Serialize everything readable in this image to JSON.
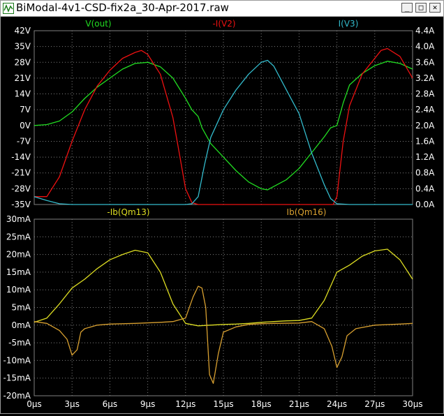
{
  "window": {
    "title": "BiModal-4v1-CSD-fix2a_30-Apr-2017.raw",
    "icon": "ltspice-waveform-icon",
    "buttons": [
      {
        "name": "minimize-button",
        "glyph": "_"
      },
      {
        "name": "maximize-button",
        "glyph": "□"
      },
      {
        "name": "close-button",
        "glyph": "✕"
      }
    ]
  },
  "colors": {
    "background": "#000000",
    "grid": "#7f7f7f",
    "axis_text": "#ffffff",
    "v_out": "#22dd22",
    "neg_i_v2": "#ee1111",
    "i_v3": "#33bbcc",
    "neg_ib_qm13": "#dddd22",
    "ib_qm16": "#d8a030"
  },
  "chart_data": [
    {
      "type": "line",
      "pane": "top",
      "left_axis": {
        "unit": "V",
        "ticks": [
          "42V",
          "35V",
          "28V",
          "21V",
          "14V",
          "7V",
          "0V",
          "-7V",
          "-14V",
          "-21V",
          "-28V",
          "-35V"
        ],
        "ylim": [
          -35,
          42
        ]
      },
      "right_axis": {
        "unit": "A",
        "ticks": [
          "4.4A",
          "4.0A",
          "3.6A",
          "3.2A",
          "2.8A",
          "2.4A",
          "2.0A",
          "1.6A",
          "1.2A",
          "0.8A",
          "0.4A",
          "0.0A"
        ],
        "ylim": [
          0.0,
          4.4
        ]
      },
      "xlim": [
        0,
        30
      ],
      "grid": true,
      "series": [
        {
          "name": "V(out)",
          "axis": "left",
          "color": "#22dd22",
          "points": [
            [
              0,
              0
            ],
            [
              1,
              0.4
            ],
            [
              2,
              2
            ],
            [
              3,
              6
            ],
            [
              4,
              12
            ],
            [
              5,
              17
            ],
            [
              6,
              21
            ],
            [
              7,
              25
            ],
            [
              8,
              27.5
            ],
            [
              9,
              28
            ],
            [
              10,
              26
            ],
            [
              11,
              21
            ],
            [
              12,
              12
            ],
            [
              12.5,
              7
            ],
            [
              13,
              4
            ],
            [
              13.3,
              -1
            ],
            [
              14,
              -8
            ],
            [
              15,
              -14
            ],
            [
              16,
              -20
            ],
            [
              17,
              -25
            ],
            [
              18,
              -28
            ],
            [
              18.5,
              -28.5
            ],
            [
              19,
              -27
            ],
            [
              20,
              -24
            ],
            [
              21,
              -19
            ],
            [
              22,
              -12
            ],
            [
              23,
              -5
            ],
            [
              23.5,
              -1
            ],
            [
              24,
              0
            ],
            [
              24.5,
              10
            ],
            [
              25,
              18
            ],
            [
              26,
              23
            ],
            [
              27,
              26.5
            ],
            [
              28,
              28.5
            ],
            [
              29,
              27.5
            ],
            [
              30,
              25
            ]
          ]
        },
        {
          "name": "-I(V2)",
          "axis": "right",
          "color": "#ee1111",
          "points": [
            [
              0,
              0.2
            ],
            [
              1,
              0.2
            ],
            [
              2,
              0.7
            ],
            [
              3,
              1.6
            ],
            [
              4,
              2.4
            ],
            [
              5,
              3.0
            ],
            [
              6,
              3.4
            ],
            [
              7,
              3.7
            ],
            [
              8,
              3.85
            ],
            [
              8.5,
              3.9
            ],
            [
              9,
              3.8
            ],
            [
              10,
              3.3
            ],
            [
              11,
              2.2
            ],
            [
              11.5,
              1.3
            ],
            [
              12,
              0.4
            ],
            [
              12.5,
              0.05
            ],
            [
              13,
              0.0
            ],
            [
              23.7,
              0.0
            ],
            [
              24,
              0.2
            ],
            [
              24.5,
              1.6
            ],
            [
              25,
              2.5
            ],
            [
              26,
              3.3
            ],
            [
              27,
              3.7
            ],
            [
              27.5,
              3.9
            ],
            [
              28,
              3.95
            ],
            [
              29,
              3.75
            ],
            [
              30,
              3.2
            ]
          ]
        },
        {
          "name": "I(V3)",
          "axis": "right",
          "color": "#33bbcc",
          "points": [
            [
              0,
              0.2
            ],
            [
              1,
              0.1
            ],
            [
              2,
              0.02
            ],
            [
              3,
              0.0
            ],
            [
              12,
              0.0
            ],
            [
              12.5,
              0.02
            ],
            [
              13,
              0.2
            ],
            [
              13.5,
              1.0
            ],
            [
              14,
              1.7
            ],
            [
              15,
              2.4
            ],
            [
              16,
              2.9
            ],
            [
              17,
              3.3
            ],
            [
              18,
              3.6
            ],
            [
              18.5,
              3.65
            ],
            [
              19,
              3.5
            ],
            [
              20,
              2.9
            ],
            [
              21,
              2.3
            ],
            [
              22,
              1.3
            ],
            [
              23,
              0.5
            ],
            [
              23.5,
              0.15
            ],
            [
              24,
              0.02
            ],
            [
              25,
              0.0
            ],
            [
              30,
              0.0
            ]
          ]
        }
      ]
    },
    {
      "type": "line",
      "pane": "bottom",
      "y_axis": {
        "unit": "mA",
        "ticks": [
          "30mA",
          "25mA",
          "20mA",
          "15mA",
          "10mA",
          "5mA",
          "0mA",
          "-5mA",
          "-10mA",
          "-15mA",
          "-20mA"
        ],
        "ylim": [
          -20,
          30
        ]
      },
      "x_axis": {
        "ticks": [
          "0µs",
          "3µs",
          "6µs",
          "9µs",
          "12µs",
          "15µs",
          "18µs",
          "21µs",
          "24µs",
          "27µs",
          "30µs"
        ],
        "xlim": [
          0,
          30
        ]
      },
      "grid": true,
      "series": [
        {
          "name": "-Ib(Qm13)",
          "color": "#dddd22",
          "points": [
            [
              0,
              0.8
            ],
            [
              1,
              2
            ],
            [
              2,
              6
            ],
            [
              3,
              10.5
            ],
            [
              4,
              13
            ],
            [
              5,
              16
            ],
            [
              6,
              18.5
            ],
            [
              7,
              20
            ],
            [
              8,
              21.2
            ],
            [
              9,
              20.5
            ],
            [
              10,
              15
            ],
            [
              11,
              6
            ],
            [
              12,
              0.5
            ],
            [
              13,
              -0.2
            ],
            [
              14,
              0
            ],
            [
              15,
              0.2
            ],
            [
              16,
              0.3
            ],
            [
              17,
              0.5
            ],
            [
              18,
              0.8
            ],
            [
              19,
              1
            ],
            [
              20,
              1.2
            ],
            [
              21,
              1.3
            ],
            [
              22,
              2
            ],
            [
              23,
              7
            ],
            [
              24,
              15
            ],
            [
              25,
              17
            ],
            [
              26,
              19.5
            ],
            [
              27,
              21
            ],
            [
              28,
              21.5
            ],
            [
              29,
              18.5
            ],
            [
              30,
              13
            ]
          ]
        },
        {
          "name": "Ib(Qm16)",
          "color": "#d8a030",
          "points": [
            [
              0,
              1
            ],
            [
              1,
              0.5
            ],
            [
              2,
              -1.5
            ],
            [
              2.6,
              -4
            ],
            [
              3,
              -8.5
            ],
            [
              3.4,
              -7
            ],
            [
              3.7,
              -2
            ],
            [
              4,
              -1
            ],
            [
              5,
              0
            ],
            [
              6,
              0.3
            ],
            [
              8,
              0.5
            ],
            [
              10,
              0.8
            ],
            [
              11,
              1
            ],
            [
              12,
              2
            ],
            [
              12.6,
              8
            ],
            [
              13,
              11
            ],
            [
              13.3,
              10.5
            ],
            [
              13.6,
              5
            ],
            [
              13.9,
              -14
            ],
            [
              14.2,
              -16.5
            ],
            [
              14.6,
              -8
            ],
            [
              15,
              -2
            ],
            [
              16,
              -0.5
            ],
            [
              17,
              0.2
            ],
            [
              18,
              0.4
            ],
            [
              19,
              0.5
            ],
            [
              21,
              0.6
            ],
            [
              22,
              1
            ],
            [
              23,
              -1
            ],
            [
              23.6,
              -6
            ],
            [
              24,
              -12
            ],
            [
              24.4,
              -9
            ],
            [
              24.8,
              -3
            ],
            [
              25.5,
              -1
            ],
            [
              27,
              0
            ],
            [
              29,
              0.3
            ],
            [
              30,
              0.5
            ]
          ]
        }
      ]
    }
  ]
}
